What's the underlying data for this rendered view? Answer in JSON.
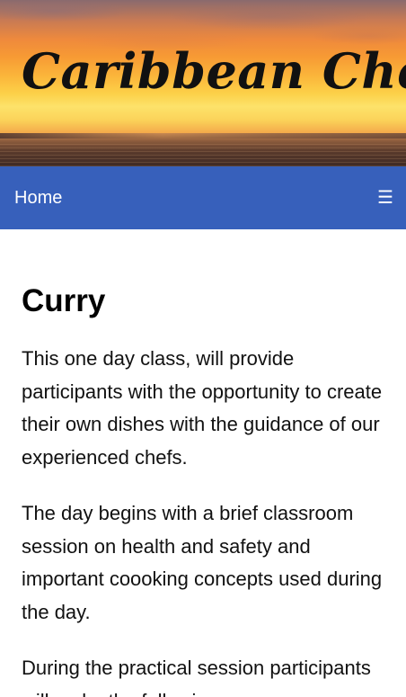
{
  "banner": {
    "title": "Caribbean Chef"
  },
  "nav": {
    "home_label": "Home",
    "menu_glyph": "☰",
    "menu_icon": "hamburger-menu-icon"
  },
  "main": {
    "title": "Curry",
    "paragraphs": [
      "This one day class, will provide participants with the opportunity to create their own dishes with the guidance of our experienced chefs.",
      "The day begins with a brief classroom session on health and safety and important coooking concepts used during the day.",
      "During the practical session participants will make the following"
    ]
  },
  "colors": {
    "nav_background": "#3760bb",
    "nav_text": "#ffffff",
    "body_text": "#111111"
  }
}
